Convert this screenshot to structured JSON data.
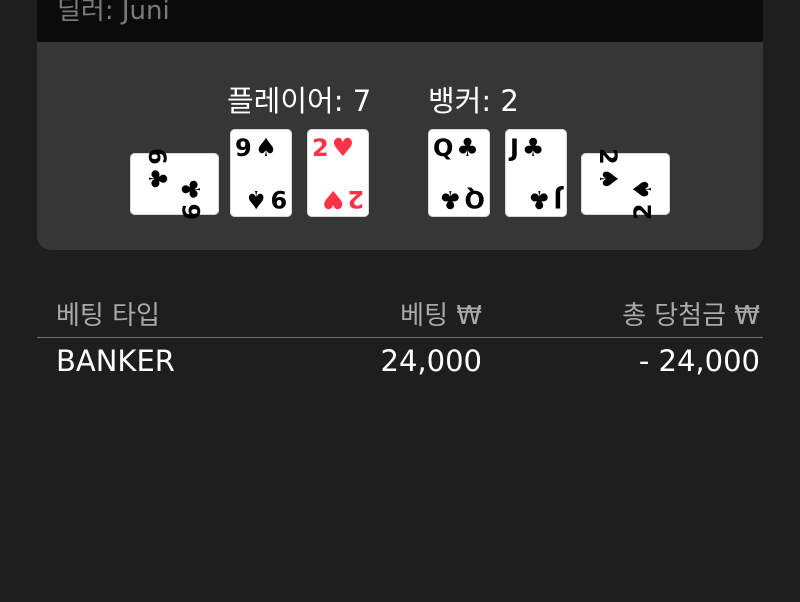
{
  "dealer_label": "딜러: Juni",
  "scores": {
    "player_label": "플레이어: 7",
    "banker_label": "뱅커: 2"
  },
  "player_cards": [
    {
      "rank": "6",
      "suit": "♣",
      "color": "#000000",
      "orientation": "sideways"
    },
    {
      "rank": "9",
      "suit": "♠",
      "color": "#000000",
      "orientation": "upright"
    },
    {
      "rank": "2",
      "suit": "♥",
      "color": "#ff3248",
      "orientation": "upright"
    }
  ],
  "banker_cards": [
    {
      "rank": "Q",
      "suit": "♣",
      "color": "#000000",
      "orientation": "upright"
    },
    {
      "rank": "J",
      "suit": "♣",
      "color": "#000000",
      "orientation": "upright"
    },
    {
      "rank": "2",
      "suit": "♠",
      "color": "#000000",
      "orientation": "sideways"
    }
  ],
  "bet_table": {
    "headers": {
      "type": "베팅 타입",
      "bet": "베팅 ₩",
      "payout": "총 당첨금 ₩"
    },
    "rows": [
      {
        "type": "BANKER",
        "bet": "24,000",
        "payout": "- 24,000"
      }
    ]
  },
  "colors": {
    "background": "#1e1e1e",
    "panel": "#363636",
    "top_bar": "#0b0b0b",
    "red_suit": "#ff3248"
  }
}
